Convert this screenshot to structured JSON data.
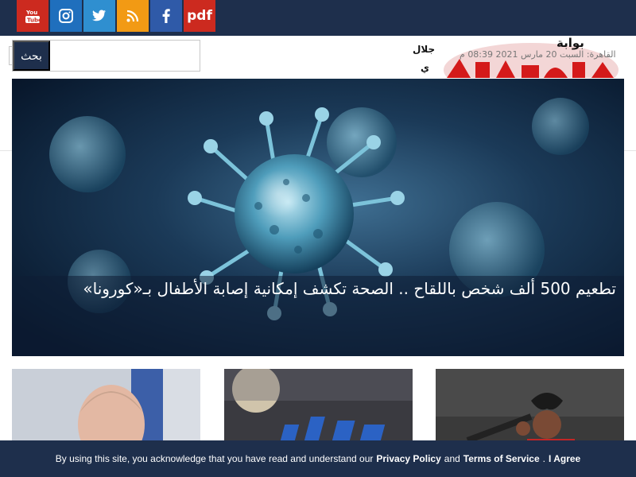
{
  "social": {
    "youtube_icon": "youtube-icon",
    "instagram_icon": "instagram-icon",
    "twitter_icon": "twitter-icon",
    "rss_icon": "rss-icon",
    "facebook_icon": "facebook-icon",
    "pdf_label": "pdf"
  },
  "header": {
    "search_button": "بحث",
    "search_value": "",
    "nav_fragment_1": "جلال",
    "nav_fragment_2": "ي",
    "logo_word": "بوابة",
    "date": "القاهرة: السبت 20 مارس 2021 08:39 م"
  },
  "hero": {
    "title": "تطعيم 500 ألف شخص باللقاح .. الصحة تكشف إمكانية إصابة الأطفال بـ«كورونا»"
  },
  "cards": [
    {
      "image": "man-portrait"
    },
    {
      "image": "fifa-logo"
    },
    {
      "image": "football-player-training"
    }
  ],
  "cookie": {
    "prefix": "By using this site, you acknowledge that you have read and understand our",
    "privacy": "Privacy Policy",
    "and": "and",
    "terms": "Terms of Service",
    "dot": ".",
    "agree": "I Agree"
  },
  "colors": {
    "brand_navy": "#1e2f4c",
    "youtube_red": "#cc2a1f",
    "rss_orange": "#f29a14"
  }
}
